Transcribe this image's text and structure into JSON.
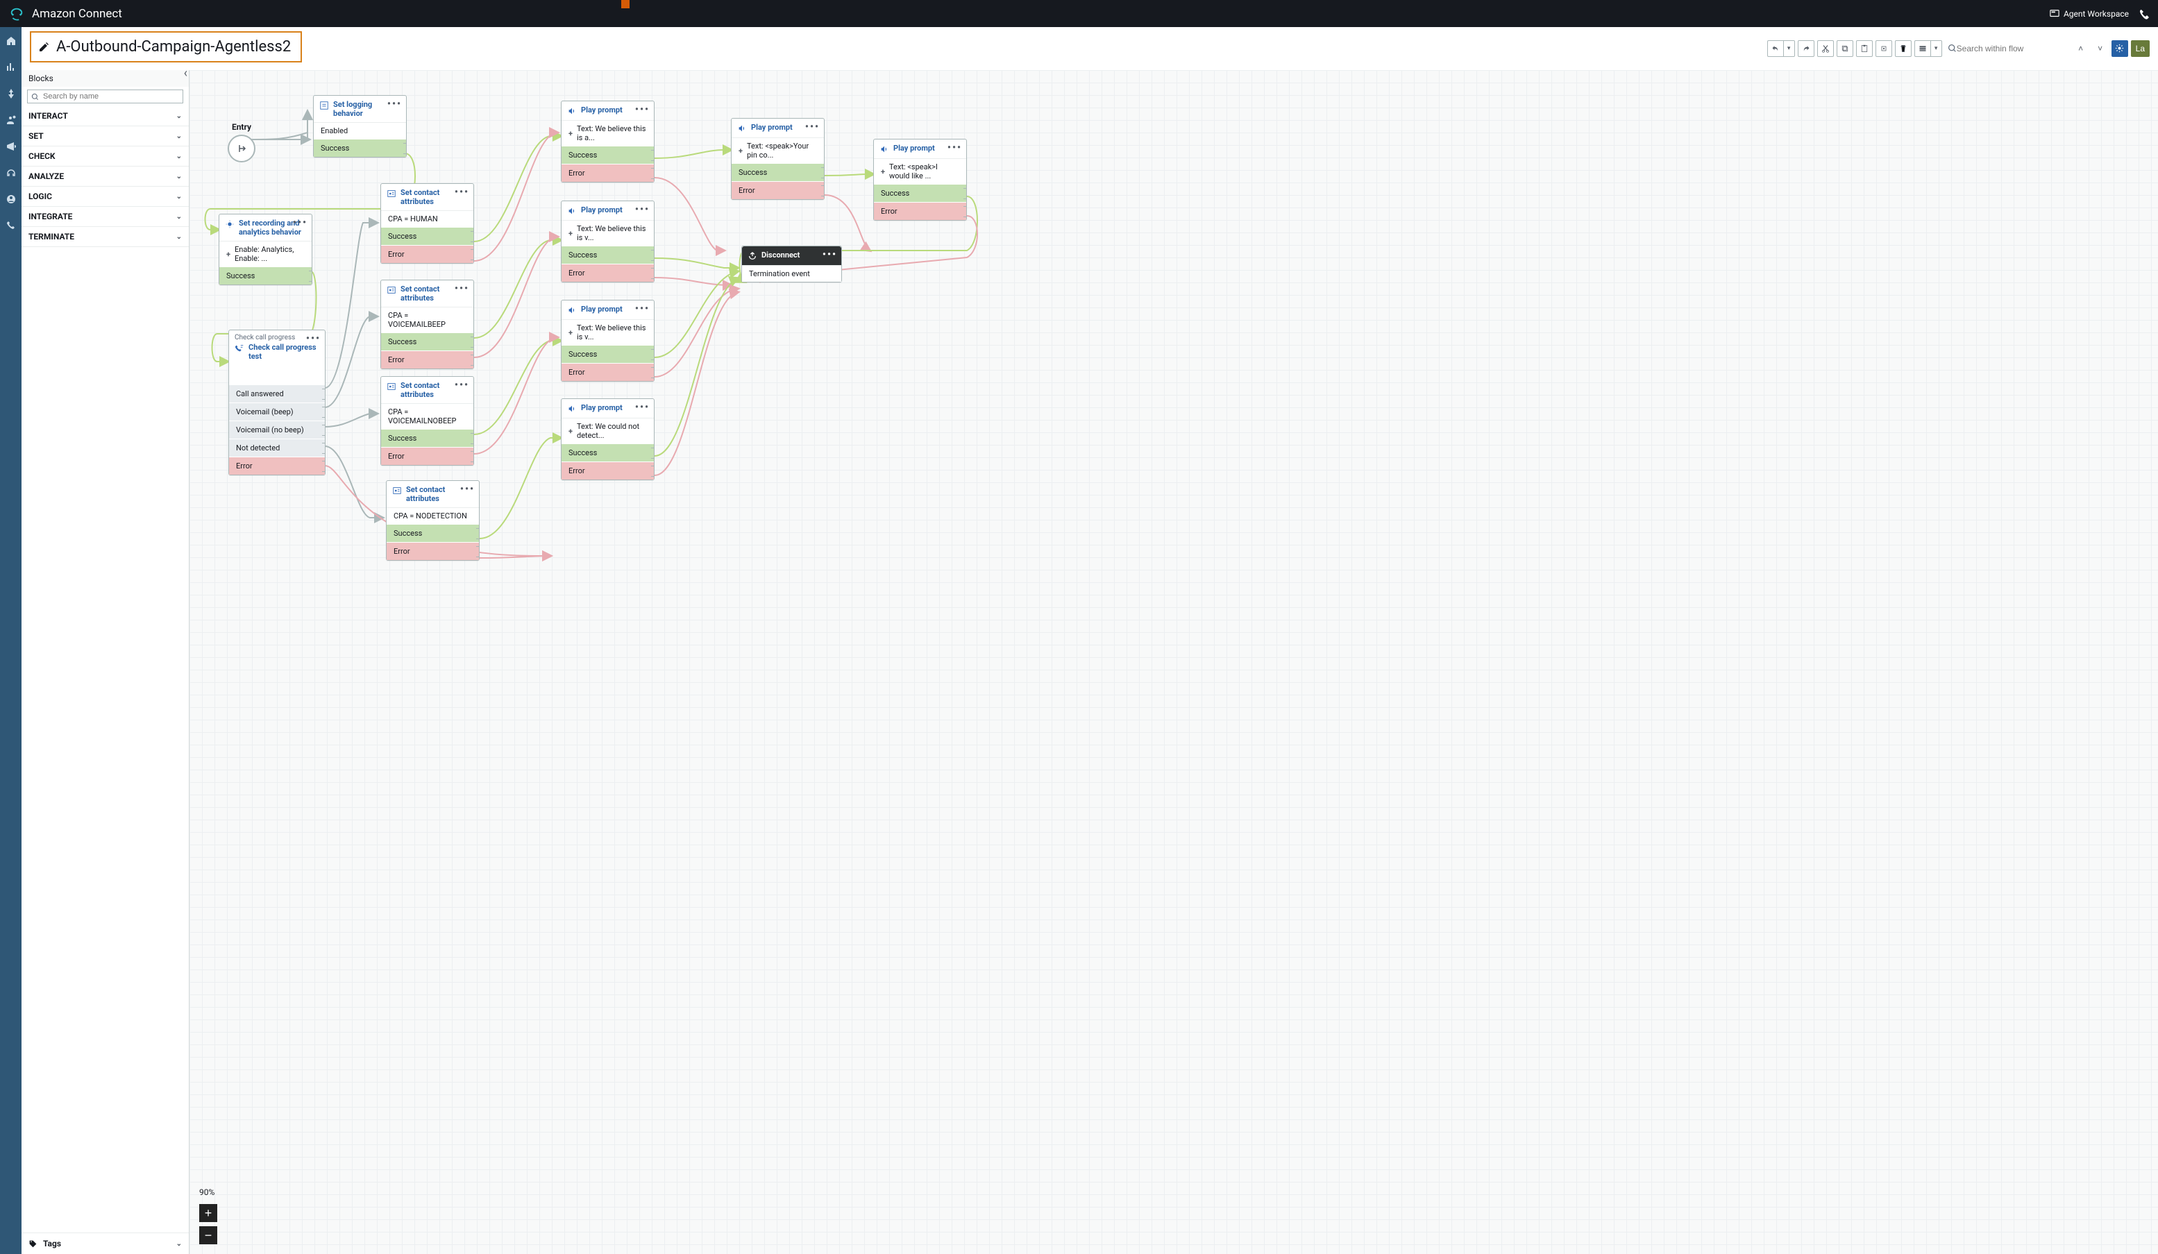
{
  "brand": "Amazon Connect",
  "topbar": {
    "agent_workspace": "Agent Workspace"
  },
  "header": {
    "flow_title": "A-Outbound-Campaign-Agentless2"
  },
  "toolbar": {
    "search_placeholder": "Search within flow",
    "save_label": "La"
  },
  "panel": {
    "title": "Blocks",
    "search_placeholder": "Search by name",
    "categories": [
      "INTERACT",
      "SET",
      "CHECK",
      "ANALYZE",
      "LOGIC",
      "INTEGRATE",
      "TERMINATE"
    ],
    "tags_label": "Tags"
  },
  "zoom": {
    "pct": "90%"
  },
  "nodes": {
    "entry": {
      "label": "Entry"
    },
    "set_logging": {
      "title": "Set logging behavior",
      "info": "Enabled",
      "b1": "Success"
    },
    "set_recording": {
      "title": "Set recording and analytics behavior",
      "info": "Enable: Analytics, Enable: ...",
      "b1": "Success"
    },
    "check_call": {
      "sub": "Check call progress",
      "title": "Check call progress test",
      "o1": "Call answered",
      "o2": "Voicemail (beep)",
      "o3": "Voicemail (no beep)",
      "o4": "Not detected",
      "o5": "Error"
    },
    "sca1": {
      "title": "Set contact attributes",
      "info": "CPA = HUMAN",
      "b1": "Success",
      "b2": "Error"
    },
    "sca2": {
      "title": "Set contact attributes",
      "info": "CPA = VOICEMAILBEEP",
      "b1": "Success",
      "b2": "Error"
    },
    "sca3": {
      "title": "Set contact attributes",
      "info": "CPA = VOICEMAILNOBEEP",
      "b1": "Success",
      "b2": "Error"
    },
    "sca4": {
      "title": "Set contact attributes",
      "info": "CPA = NODETECTION",
      "b1": "Success",
      "b2": "Error"
    },
    "pp1": {
      "title": "Play prompt",
      "info": "Text: We believe this is a...",
      "b1": "Success",
      "b2": "Error"
    },
    "pp2": {
      "title": "Play prompt",
      "info": "Text: We believe this is v...",
      "b1": "Success",
      "b2": "Error"
    },
    "pp3": {
      "title": "Play prompt",
      "info": "Text: We believe this is v...",
      "b1": "Success",
      "b2": "Error"
    },
    "pp4": {
      "title": "Play prompt",
      "info": "Text: We could not detect...",
      "b1": "Success",
      "b2": "Error"
    },
    "pp5": {
      "title": "Play prompt",
      "info": "Text: <speak>Your pin co...",
      "b1": "Success",
      "b2": "Error"
    },
    "pp6": {
      "title": "Play prompt",
      "info": "Text: <speak>I would like ...",
      "b1": "Success",
      "b2": "Error"
    },
    "disc": {
      "title": "Disconnect",
      "info": "Termination event"
    }
  }
}
